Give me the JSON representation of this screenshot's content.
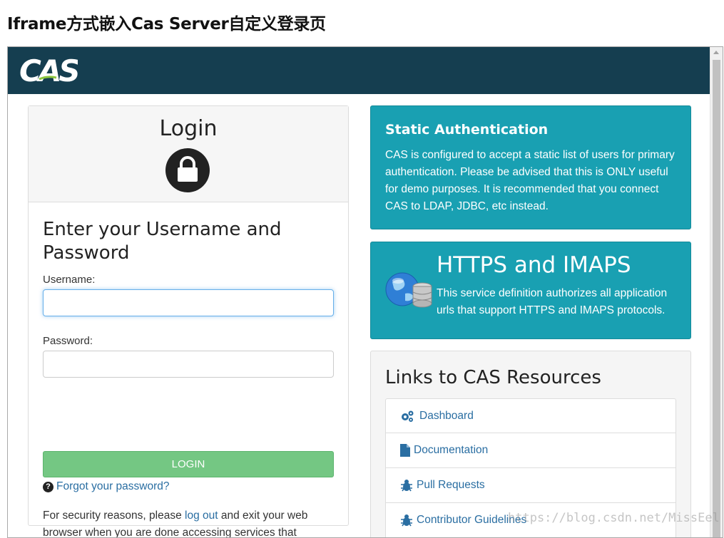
{
  "page": {
    "title": "Iframe方式嵌入Cas Server自定义登录页"
  },
  "header": {
    "logo_text": "CAS"
  },
  "login": {
    "title": "Login",
    "heading": "Enter your Username and Password",
    "username_label": "Username:",
    "username_value": "",
    "password_label": "Password:",
    "password_value": "",
    "button_label": "LOGIN",
    "forgot_label": "Forgot your password?",
    "security_prefix": "For security reasons, please ",
    "security_link": "log out",
    "security_suffix": " and exit your web browser when you are done accessing services that require authentication!"
  },
  "static_auth": {
    "title": "Static Authentication",
    "text": "CAS is configured to accept a static list of users for primary authentication. Please be advised that this is ONLY useful for demo purposes. It is recommended that you connect CAS to LDAP, JDBC, etc instead."
  },
  "https": {
    "title": "HTTPS and IMAPS",
    "text": "This service definition authorizes all application urls that support HTTPS and IMAPS protocols."
  },
  "resources": {
    "title": "Links to CAS Resources",
    "items": [
      {
        "label": "Dashboard",
        "icon": "gears-icon"
      },
      {
        "label": "Documentation",
        "icon": "document-icon"
      },
      {
        "label": "Pull Requests",
        "icon": "bug-icon"
      },
      {
        "label": "Contributor Guidelines",
        "icon": "bug-icon"
      }
    ]
  },
  "watermark": "https://blog.csdn.net/MissEel",
  "colors": {
    "header": "#153e50",
    "teal_panel": "#19a0b2",
    "login_button": "#74c783",
    "link": "#2a6ea2"
  }
}
